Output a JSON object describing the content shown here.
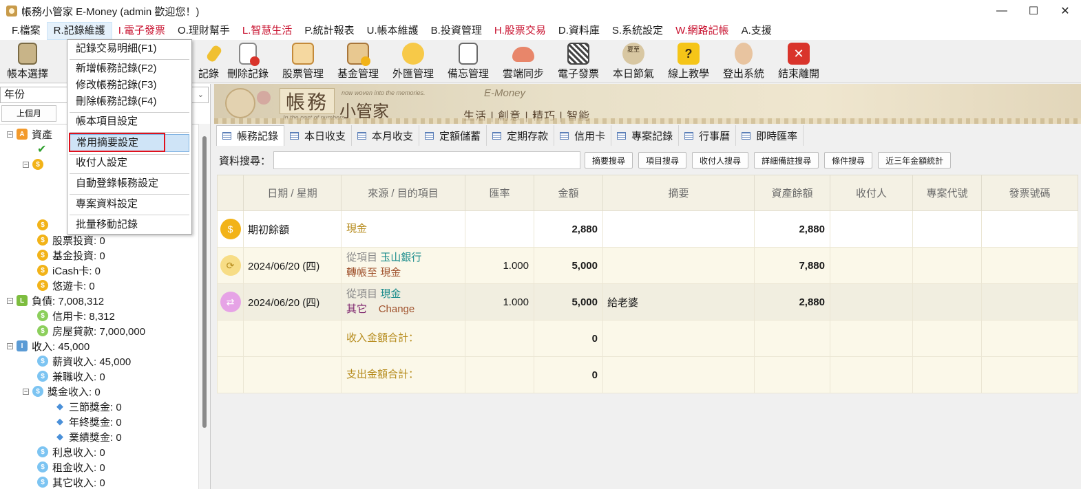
{
  "window": {
    "title": "帳務小管家 E-Money (admin 歡迎您！)",
    "minimize": "—",
    "maximize": "☐",
    "close": "✕"
  },
  "menubar": [
    {
      "label": "F.檔案",
      "color": "#1a1a1a"
    },
    {
      "label": "R.記錄維護",
      "color": "#1a1a1a",
      "active": true
    },
    {
      "label": "I.電子發票",
      "color": "#c8102e"
    },
    {
      "label": "O.理財幫手",
      "color": "#1a1a1a"
    },
    {
      "label": "L.智慧生活",
      "color": "#c8102e"
    },
    {
      "label": "P.統計報表",
      "color": "#1a1a1a"
    },
    {
      "label": "U.帳本維護",
      "color": "#1a1a1a"
    },
    {
      "label": "B.投資管理",
      "color": "#1a1a1a"
    },
    {
      "label": "H.股票交易",
      "color": "#c8102e"
    },
    {
      "label": "D.資料庫",
      "color": "#1a1a1a"
    },
    {
      "label": "S.系統設定",
      "color": "#1a1a1a"
    },
    {
      "label": "W.網路記帳",
      "color": "#c8102e"
    },
    {
      "label": "A.支援",
      "color": "#1a1a1a"
    }
  ],
  "toolbar": [
    {
      "label": "帳本選擇",
      "icon": "ledger-book-icon"
    },
    {
      "label": "記錄",
      "icon": "edit-record-icon"
    },
    {
      "label": "刪除記錄",
      "icon": "delete-record-icon"
    },
    {
      "label": "股票管理",
      "icon": "stock-icon"
    },
    {
      "label": "基金管理",
      "icon": "fund-icon"
    },
    {
      "label": "外匯管理",
      "icon": "forex-icon"
    },
    {
      "label": "備忘管理",
      "icon": "memo-icon"
    },
    {
      "label": "雲端同步",
      "icon": "cloud-sync-icon"
    },
    {
      "label": "電子發票",
      "icon": "qr-invoice-icon"
    },
    {
      "label": "本日節氣",
      "icon": "solar-term-icon",
      "badge": "夏至"
    },
    {
      "label": "線上教學",
      "icon": "help-icon"
    },
    {
      "label": "登出系統",
      "icon": "logout-user-icon"
    },
    {
      "label": "結束離開",
      "icon": "exit-icon"
    }
  ],
  "dropdown": {
    "items": [
      "記錄交易明細(F1)",
      "新增帳務記錄(F2)",
      "修改帳務記錄(F3)",
      "刪除帳務記錄(F4)",
      "帳本項目設定",
      "常用摘要設定",
      "收付人設定",
      "自動登錄帳務設定",
      "專案資料設定",
      "批量移動記錄"
    ]
  },
  "left": {
    "year_label": "年份",
    "prev_month": "上個月",
    "tree": [
      {
        "label": "資產",
        "level": 0,
        "node": "A"
      },
      {
        "label": "股票投資: 0",
        "level": 1
      },
      {
        "label": "基金投資: 0",
        "level": 1
      },
      {
        "label": "iCash卡: 0",
        "level": 1
      },
      {
        "label": "悠遊卡: 0",
        "level": 1
      },
      {
        "label": "負債: 7,008,312",
        "level": 0,
        "node": "L"
      },
      {
        "label": "信用卡: 8,312",
        "level": 1
      },
      {
        "label": "房屋貸款: 7,000,000",
        "level": 1
      },
      {
        "label": "收入: 45,000",
        "level": 0,
        "node": "I"
      },
      {
        "label": "薪資收入: 45,000",
        "level": 1
      },
      {
        "label": "兼職收入: 0",
        "level": 1
      },
      {
        "label": "獎金收入: 0",
        "level": 1
      },
      {
        "label": "三節獎金: 0",
        "level": 2
      },
      {
        "label": "年終獎金: 0",
        "level": 2
      },
      {
        "label": "業績獎金: 0",
        "level": 2
      },
      {
        "label": "利息收入: 0",
        "level": 1
      },
      {
        "label": "租金收入: 0",
        "level": 1
      },
      {
        "label": "其它收入: 0",
        "level": 1
      }
    ]
  },
  "banner": {
    "title_box": "帳務",
    "title_sub": "小管家",
    "tagline_top": "now woven into the memories.",
    "tagline_bottom": "In the past of numbers.",
    "brand": "E-Money",
    "slogan": "生活 | 創意 | 精巧 | 智能"
  },
  "tabs": [
    "帳務記錄",
    "本日收支",
    "本月收支",
    "定額儲蓄",
    "定期存款",
    "信用卡",
    "專案記錄",
    "行事曆",
    "即時匯率"
  ],
  "search": {
    "label": "資料搜尋：",
    "value": "",
    "buttons": [
      "摘要搜尋",
      "項目搜尋",
      "收付人搜尋",
      "詳細備註搜尋",
      "條件搜尋",
      "近三年金額統計"
    ]
  },
  "grid": {
    "headers": [
      "",
      "日期 / 星期",
      "來源 / 目的項目",
      "匯率",
      "金額",
      "摘要",
      "資產餘額",
      "收付人",
      "專案代號",
      "發票號碼"
    ],
    "rows": [
      {
        "date": "期初餘額",
        "src1a": "現金",
        "src1b": "",
        "src2a": "",
        "src2b": "",
        "rate": "",
        "amount": "2,880",
        "memo": "",
        "balance": "2,880"
      },
      {
        "date": "2024/06/20 (四)",
        "src1a": "從項目",
        "src1b": "玉山銀行",
        "src2a": "轉帳至",
        "src2b": "現金",
        "rate": "1.000",
        "amount": "5,000",
        "memo": "",
        "balance": "7,880"
      },
      {
        "date": "2024/06/20 (四)",
        "src1a": "從項目",
        "src1b": "現金",
        "src2a": "其它",
        "src2b": "Change",
        "rate": "",
        "rate2": "1.000",
        "amount": "5,000",
        "memo": "給老婆",
        "balance": "2,880"
      },
      {
        "label": "收入金額合計：",
        "amount": "0"
      },
      {
        "label": "支出金額合計：",
        "amount": "0"
      }
    ]
  }
}
